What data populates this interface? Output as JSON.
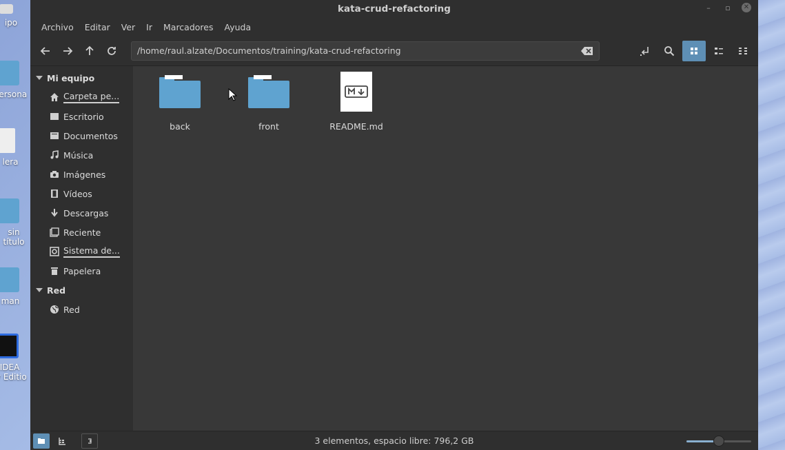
{
  "desktop": {
    "icons": [
      {
        "label": "ipo",
        "kind": "folder"
      },
      {
        "label": "persona",
        "kind": "folder"
      },
      {
        "label": "lera",
        "kind": "trash"
      },
      {
        "label": "sin título",
        "kind": "folder"
      },
      {
        "label": "man",
        "kind": "folder"
      },
      {
        "label": "IDEA\nty Editio",
        "kind": "app"
      }
    ]
  },
  "window": {
    "title": "kata-crud-refactoring",
    "menu": [
      "Archivo",
      "Editar",
      "Ver",
      "Ir",
      "Marcadores",
      "Ayuda"
    ],
    "location_path": "/home/raul.alzate/Documentos/training/kata-crud-refactoring"
  },
  "sidebar": {
    "sections": [
      {
        "title": "Mi equipo",
        "items": [
          {
            "label": "Carpeta pe...",
            "icon": "home-icon",
            "mounted": true
          },
          {
            "label": "Escritorio",
            "icon": "desktop-icon",
            "mounted": false
          },
          {
            "label": "Documentos",
            "icon": "documents-icon",
            "mounted": false
          },
          {
            "label": "Música",
            "icon": "music-icon",
            "mounted": false
          },
          {
            "label": "Imágenes",
            "icon": "camera-icon",
            "mounted": false
          },
          {
            "label": "Vídeos",
            "icon": "film-icon",
            "mounted": false
          },
          {
            "label": "Descargas",
            "icon": "download-icon",
            "mounted": false
          },
          {
            "label": "Reciente",
            "icon": "recent-icon",
            "mounted": false
          },
          {
            "label": "Sistema de...",
            "icon": "drive-icon",
            "mounted": true
          },
          {
            "label": "Papelera",
            "icon": "trash-icon",
            "mounted": false
          }
        ]
      },
      {
        "title": "Red",
        "items": [
          {
            "label": "Red",
            "icon": "globe-icon",
            "mounted": false
          }
        ]
      }
    ]
  },
  "files": [
    {
      "name": "back",
      "type": "folder"
    },
    {
      "name": "front",
      "type": "folder"
    },
    {
      "name": "README.md",
      "type": "markdown"
    }
  ],
  "status": {
    "text": "3 elementos, espacio libre: 796,2 GB",
    "zoom_level": 0.5
  },
  "colors": {
    "accent": "#5e8fb5",
    "folder": "#5fa3d0",
    "window_bg": "#383838",
    "chrome_bg": "#2f2f2f"
  }
}
